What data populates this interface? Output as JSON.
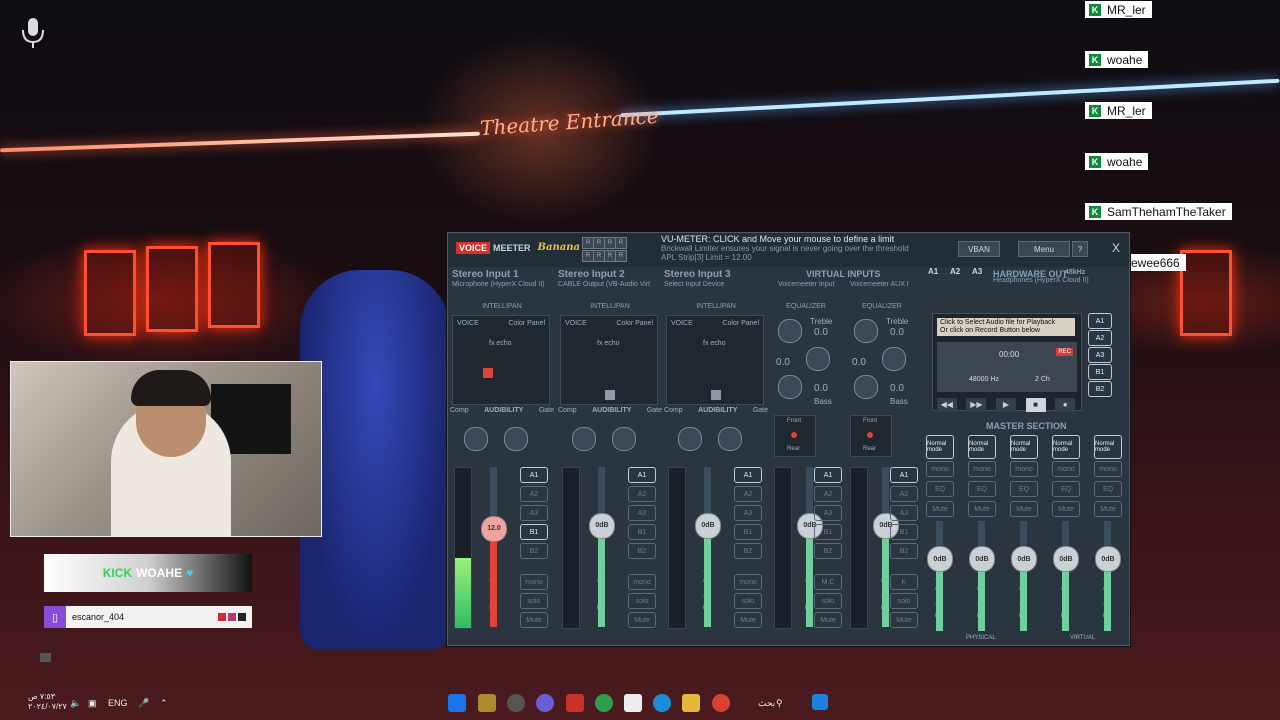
{
  "scene": {
    "neon_sign": "Theatre Entrance"
  },
  "chat": {
    "messages": [
      {
        "user": "MR_ler"
      },
      {
        "user": "woahe"
      },
      {
        "user": "MR_ler"
      },
      {
        "user": "woahe"
      },
      {
        "user": "SamThehamTheTaker"
      },
      {
        "user": "wewewee666"
      }
    ]
  },
  "overlay": {
    "sub_highlight": "KICK",
    "sub_name": "WOAHE",
    "twitch_user": "escanor_404"
  },
  "voicemeeter": {
    "logo_voice": "VOICE",
    "logo_meeter": "MEETER",
    "logo_banana": "Banana",
    "r_buttons": [
      "R",
      "R",
      "R",
      "R",
      "R",
      "R",
      "R",
      "R"
    ],
    "a_label": "A",
    "info_title": "VU-METER: CLICK and Move your mouse to define a limit",
    "info_line2": "Brickwall Limiter ensures your signal is never going over the threshold",
    "info_line3": "APL Strip[3] Limit = 12.00",
    "vban": "VBAN",
    "menu": "Menu",
    "help": "?",
    "close": "X",
    "inputs": [
      {
        "title": "Stereo Input 1",
        "device": "Microphone (HyperX Cloud II)"
      },
      {
        "title": "Stereo Input 2",
        "device": "CABLE Output (VB-Audio Virt"
      },
      {
        "title": "Stereo Input 3",
        "device": "Select Input Device"
      }
    ],
    "virtual_inputs": "VIRTUAL INPUTS",
    "virtual_names": [
      "Voicemeeter Input",
      "Voicemeeter AUX I"
    ],
    "hw_buses": [
      "A1",
      "A2",
      "A3"
    ],
    "hardware_out": "HARDWARE OUT",
    "hardware_rate": "48kHz",
    "hardware_device": "Headphones (HyperX Cloud II)",
    "intellipan": "INTELLIPAN",
    "equalizer": "EQUALIZER",
    "voice": "VOICE",
    "color_panel": "Color Panel",
    "fx_echo": "fx echo",
    "comp": "Comp",
    "audibility": "AUDIBILITY",
    "gate": "Gate",
    "treble": "Treble",
    "bass": "Bass",
    "eq_values": [
      "0.0",
      "0.0",
      "0.0",
      "0.0",
      "0.0",
      "0.0"
    ],
    "front": "Front",
    "rear": "Rear",
    "fader_gain": "Fader Gain",
    "strip_faders": [
      "12.0",
      "0dB",
      "0dB",
      "0dB",
      "0dB"
    ],
    "strip_fill": [
      0.62,
      0.64,
      0.64,
      0.64,
      0.64
    ],
    "bus_buttons": [
      "A1",
      "A2",
      "A3",
      "B1",
      "B2"
    ],
    "mono": "mono",
    "solo": "solo",
    "mute": "Mute",
    "mc": "M.C",
    "k": "K",
    "player": {
      "line1": "Click to Select Audio file for Playback",
      "line2": "Or click on Record Button below",
      "time": "00:00",
      "rate": "48000 Hz",
      "channels": "2 Ch",
      "rec": "REC"
    },
    "player_buses": [
      "A1",
      "A2",
      "A3",
      "B1",
      "B2"
    ],
    "master_section": "MASTER SECTION",
    "normal_mode": "Normal mode",
    "eq_btn": "EQ",
    "master_faders": [
      "0dB",
      "0dB",
      "0dB",
      "0dB",
      "0dB"
    ],
    "master_fill": [
      0.66,
      0.66,
      0.66,
      0.66,
      0.66
    ],
    "physical": "PHYSICAL",
    "virtual": "VIRTUAL"
  },
  "taskbar": {
    "search": "بحث",
    "lang": "ENG",
    "time": "٧:٥٣ ص",
    "date": "٢٠٢٤/٠٧/٢٧"
  },
  "colors": {
    "accent_red": "#e0443c",
    "fader_green": "#6fcf9f",
    "chat_green": "#0d8a3a"
  }
}
